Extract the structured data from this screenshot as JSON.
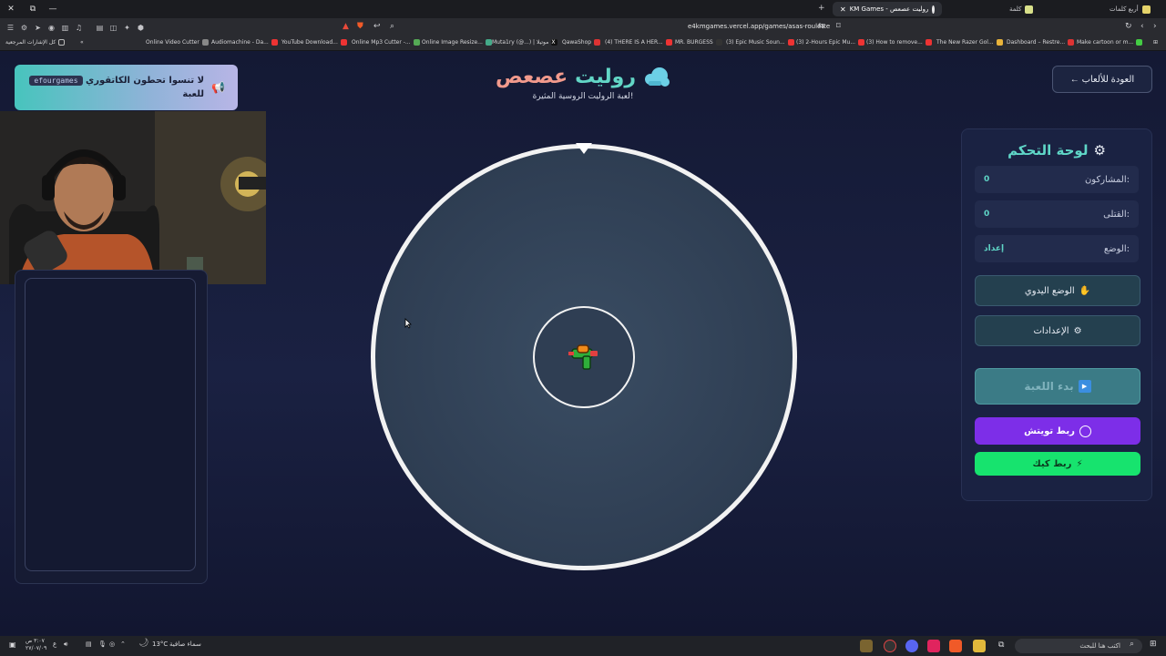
{
  "browser": {
    "tabs": [
      {
        "label": "KM Games - روليت عصعص",
        "active": true
      },
      {
        "label": "كلمة",
        "active": false
      },
      {
        "label": "أربع كلمات",
        "active": false
      }
    ],
    "url": "e4kmgames.vercel.app/games/asas-roulette",
    "bookmarks": [
      "كل الإشارات المرجعية",
      "Online Video Cutter",
      "Audiomachine - Da...",
      "YouTube Download...",
      "Online Mp3 Cutter -...",
      "Online Image Resize...",
      "Muta1ry (@...) | موتيلا",
      "QawaShop",
      "(4) THERE IS A HER...",
      "MR. BURGESS",
      "(3) Epic Music Soun...",
      "(3) 2-Hours Epic Mu...",
      "(3) How to remove...",
      "The New Razer Gol...",
      "Dashboard – Restre...",
      "Make cartoon or m..."
    ]
  },
  "page": {
    "back_button": "← العودة للألعاب",
    "title_part1": "روليت",
    "title_part2": "عصعص",
    "subtitle": "لعبة الروليت الروسية المثيرة!",
    "banner": {
      "text_line1": "لا تنسوا تحطون الكاتقوري",
      "code": "efourgames",
      "text_line2": "للعبة"
    },
    "control_panel": {
      "title": "لوحة التحكم",
      "stats": [
        {
          "label": "المشاركون:",
          "value": "0"
        },
        {
          "label": "القتلى:",
          "value": "0"
        },
        {
          "label": "الوضع:",
          "value": "إعداد"
        }
      ],
      "manual_mode": "الوضع اليدوي",
      "settings": "الإعدادات",
      "start_game": "بدء اللعبة",
      "link_tiktok": "ربط تويتش",
      "link_kick": "ربط كيك"
    }
  },
  "taskbar": {
    "time": "٣:٠٧ ص",
    "date": "٢٧/٠٧/٠٩",
    "weather_temp": "13°C",
    "weather_text": "سماء صافية",
    "search_placeholder": "اكتب هنا للبحث",
    "lang": "ع"
  },
  "colors": {
    "accent_teal": "#5fd6c7",
    "title_pink": "#f29a8c",
    "tiktok_purple": "#7d2ee8",
    "kick_green": "#17e36e",
    "wheel_face": "#34455a",
    "wheel_rim": "#f2f2f2"
  }
}
